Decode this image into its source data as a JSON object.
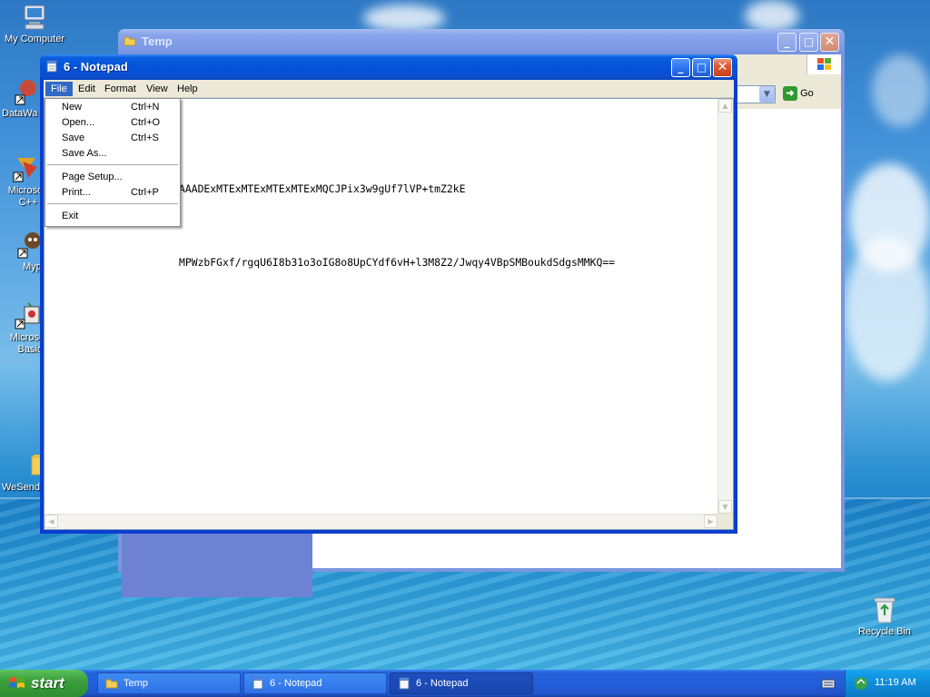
{
  "desktop": {
    "icons": [
      {
        "label": "My Computer"
      },
      {
        "label": "DataWa"
      },
      {
        "label": "Microsoft C++"
      },
      {
        "label": "Myp"
      },
      {
        "label": "Microsoft Basic"
      },
      {
        "label": "WeSendi"
      },
      {
        "label": "Recycle Bin"
      }
    ]
  },
  "explorer_window": {
    "title": "Temp",
    "go_label": "Go"
  },
  "notepad": {
    "title": "6 - Notepad",
    "menu": [
      "File",
      "Edit",
      "Format",
      "View",
      "Help"
    ],
    "content_lines": [
      "AAADExMTExMTExMTExMTExMQCJPix3w9gUf7lVP+tmZ2kE",
      "MPWzbFGxf/rgqU6I8b31o3oIG8o8UpCYdf6vH+l3M8Z2/Jwqy4VBpSMBoukdSdgsMMKQ=="
    ]
  },
  "file_menu": {
    "items": [
      {
        "label": "New",
        "shortcut": "Ctrl+N"
      },
      {
        "label": "Open...",
        "shortcut": "Ctrl+O"
      },
      {
        "label": "Save",
        "shortcut": "Ctrl+S"
      },
      {
        "label": "Save As...",
        "shortcut": ""
      },
      {
        "label": "Page Setup...",
        "shortcut": ""
      },
      {
        "label": "Print...",
        "shortcut": "Ctrl+P"
      },
      {
        "label": "Exit",
        "shortcut": ""
      }
    ]
  },
  "taskbar": {
    "start_label": "start",
    "buttons": [
      {
        "label": "Temp"
      },
      {
        "label": "6 - Notepad"
      },
      {
        "label": "6 - Notepad"
      }
    ],
    "clock": "11:19 AM"
  }
}
